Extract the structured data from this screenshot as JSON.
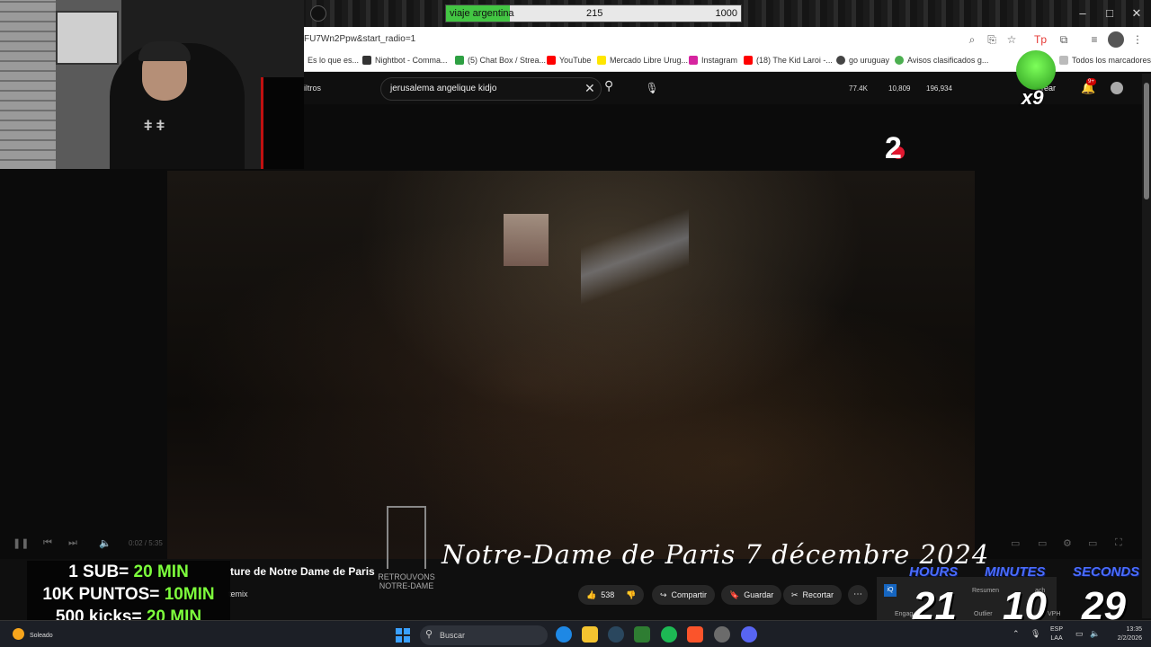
{
  "stream_goal": {
    "label": "viaje argentina",
    "current": "215",
    "max": "1000",
    "progress": 0.215
  },
  "window_controls": {
    "minimize": "–",
    "maximize": "□",
    "close": "✕"
  },
  "address": {
    "url": "FU7Wn2Ppw&start_radio=1"
  },
  "bookmarks": [
    {
      "label": "Es lo que es...",
      "icon_color": "#888888"
    },
    {
      "label": "Nightbot - Comma...",
      "icon_color": "#333333"
    },
    {
      "label": "(5) Chat Box / Strea...",
      "icon_color": "#2ea043"
    },
    {
      "label": "YouTube",
      "icon_color": "#ff0000"
    },
    {
      "label": "Mercado Libre Urug...",
      "icon_color": "#ffe600"
    },
    {
      "label": "Instagram",
      "icon_color": "#d6249f"
    },
    {
      "label": "(18) The Kid Laroi -...",
      "icon_color": "#ff0000"
    },
    {
      "label": "go uruguay",
      "icon_color": "#444444"
    },
    {
      "label": "Avisos clasificados g...",
      "icon_color": "#4caf50"
    },
    {
      "label": "Todos los marcadores",
      "icon_color": "#999999"
    }
  ],
  "youtube": {
    "filters_label": "iltros",
    "search_query": "jerusalema angelique kidjo",
    "stats": [
      "77.4K",
      "10,809",
      "196,934"
    ],
    "create_label": "rear",
    "notification_badge": "9+"
  },
  "emote": {
    "count": "x9"
  },
  "video": {
    "channel_logo": "2",
    "watermark": "RETROUVONS NOTRE-DAME",
    "caption": "Notre-Dame de Paris 7 décembre 2024",
    "time": "0:02 / 5:35",
    "title": "ture de Notre Dame de Paris",
    "channel_name": "temix"
  },
  "actions": {
    "likes": "538",
    "share": "Compartir",
    "save": "Guardar",
    "clip": "Recortar"
  },
  "sub_overlay": [
    {
      "prefix": "1 SUB= ",
      "value": "20 MIN"
    },
    {
      "prefix": "10K PUNTOS= ",
      "value": "10MIN"
    },
    {
      "prefix": "500 kicks= ",
      "value": "20 MIN"
    }
  ],
  "timer": {
    "hours_label": "HOURS",
    "minutes_label": "MINUTES",
    "seconds_label": "SECONDS",
    "hours": "21",
    "minutes": "10",
    "seconds": "29",
    "behind": [
      "Resumen",
      "ach",
      "Engag",
      "Outlier",
      "VPH"
    ]
  },
  "taskbar": {
    "weather": "Soleado",
    "search_placeholder": "Buscar",
    "lang": "ESP",
    "lang2": "LAA",
    "time": "13:35",
    "date": "2/2/2026",
    "apps": [
      "#1e88e5",
      "#f4c430",
      "#2a475e",
      "#2e7d32",
      "#1db954",
      "#fb542b",
      "#6b6b6b",
      "#5865f2"
    ]
  },
  "colors": {
    "accent_green": "#7dff3c",
    "timer_blue": "#4a6cff",
    "yt_red": "#ff0000"
  }
}
